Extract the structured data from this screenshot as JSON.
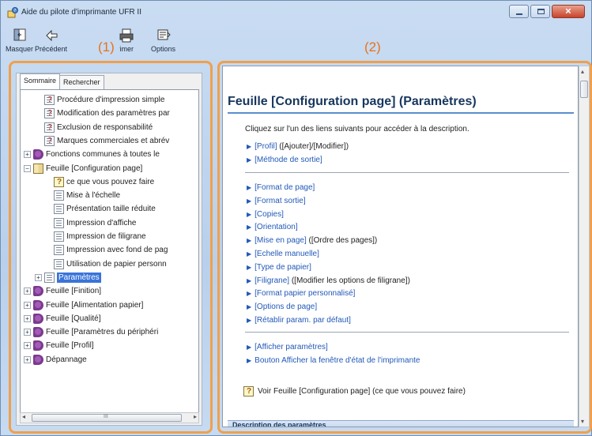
{
  "window": {
    "title": "Aide du pilote d'imprimante UFR II"
  },
  "toolbar": {
    "items": [
      {
        "label": "Masquer",
        "icon": "hide-icon"
      },
      {
        "label": "Précédent",
        "icon": "back-arrow-icon"
      },
      {
        "label": "Imprimer",
        "icon": "print-icon"
      },
      {
        "label": "Options",
        "icon": "options-icon"
      }
    ]
  },
  "callouts": {
    "left": "(1)",
    "right": "(2)"
  },
  "tabs": {
    "sommaire": "Sommaire",
    "rechercher": "Rechercher"
  },
  "tree": [
    {
      "label": "Procédure d'impression simple",
      "icon": "help-page-icon",
      "level": 1
    },
    {
      "label": "Modification des paramètres par",
      "icon": "help-page-icon",
      "level": 1
    },
    {
      "label": "Exclusion de responsabilité",
      "icon": "help-page-icon",
      "level": 1
    },
    {
      "label": "Marques commerciales et abrév",
      "icon": "help-page-icon",
      "level": 1
    },
    {
      "label": "Fonctions communes à toutes le",
      "icon": "book-icon",
      "level": 0,
      "toggle": "+"
    },
    {
      "label": "Feuille [Configuration page]",
      "icon": "open-book-icon",
      "level": 0,
      "toggle": "−"
    },
    {
      "label": "ce que vous pouvez faire",
      "icon": "tips-icon",
      "level": 2
    },
    {
      "label": "Mise à l'échelle",
      "icon": "page-icon",
      "level": 2
    },
    {
      "label": "Présentation taille réduite",
      "icon": "page-icon",
      "level": 2
    },
    {
      "label": "Impression d'affiche",
      "icon": "page-icon",
      "level": 2
    },
    {
      "label": "Impression de filigrane",
      "icon": "page-icon",
      "level": 2
    },
    {
      "label": "Impression avec fond de pag",
      "icon": "page-icon",
      "level": 2
    },
    {
      "label": "Utilisation de papier personn",
      "icon": "page-icon",
      "level": 2
    },
    {
      "label": "Paramètres",
      "icon": "page-icon",
      "level": 1,
      "toggle": "+",
      "selected": true
    },
    {
      "label": "Feuille [Finition]",
      "icon": "book-icon",
      "level": 0,
      "toggle": "+"
    },
    {
      "label": "Feuille [Alimentation papier]",
      "icon": "book-icon",
      "level": 0,
      "toggle": "+"
    },
    {
      "label": "Feuille [Qualité]",
      "icon": "book-icon",
      "level": 0,
      "toggle": "+"
    },
    {
      "label": "Feuille [Paramètres du périphéri",
      "icon": "book-icon",
      "level": 0,
      "toggle": "+"
    },
    {
      "label": "Feuille [Profil]",
      "icon": "book-icon",
      "level": 0,
      "toggle": "+"
    },
    {
      "label": "Dépannage",
      "icon": "book-icon",
      "level": 0,
      "toggle": "+"
    }
  ],
  "scroll_thumb_text": "III",
  "content": {
    "title": "Feuille [Configuration page] (Paramètres)",
    "intro": "Cliquez sur l'un des liens suivants pour accéder à la description.",
    "group1": [
      {
        "text": "[Profil]",
        "extra": " ([Ajouter]/[Modifier])"
      },
      {
        "text": "[Méthode de sortie]",
        "extra": ""
      }
    ],
    "group2": [
      {
        "text": "[Format de page]",
        "extra": ""
      },
      {
        "text": "[Format sortie]",
        "extra": ""
      },
      {
        "text": "[Copies]",
        "extra": ""
      },
      {
        "text": "[Orientation]",
        "extra": ""
      },
      {
        "text": "[Mise en page]",
        "extra": " ([Ordre des pages])"
      },
      {
        "text": "[Echelle manuelle]",
        "extra": ""
      },
      {
        "text": "[Type de papier]",
        "extra": ""
      },
      {
        "text": "[Filigrane]",
        "extra": " ([Modifier les options de filigrane])"
      },
      {
        "text": "[Format papier personnalisé]",
        "extra": ""
      },
      {
        "text": "[Options de page]",
        "extra": ""
      },
      {
        "text": "[Rétablir param. par défaut]",
        "extra": ""
      }
    ],
    "group3": [
      {
        "text": "[Afficher paramètres]",
        "extra": ""
      },
      {
        "text": "Bouton Afficher la fenêtre d'état de l'imprimante",
        "extra": ""
      }
    ],
    "voir": "Voir Feuille [Configuration page] (ce que vous pouvez faire)",
    "bottom_heading": "Description des paramètres"
  },
  "colors": {
    "accent_orange": "#f0a04b",
    "heading_blue": "#17365d",
    "link_blue": "#2259b8",
    "selection_blue": "#3a74d8"
  }
}
